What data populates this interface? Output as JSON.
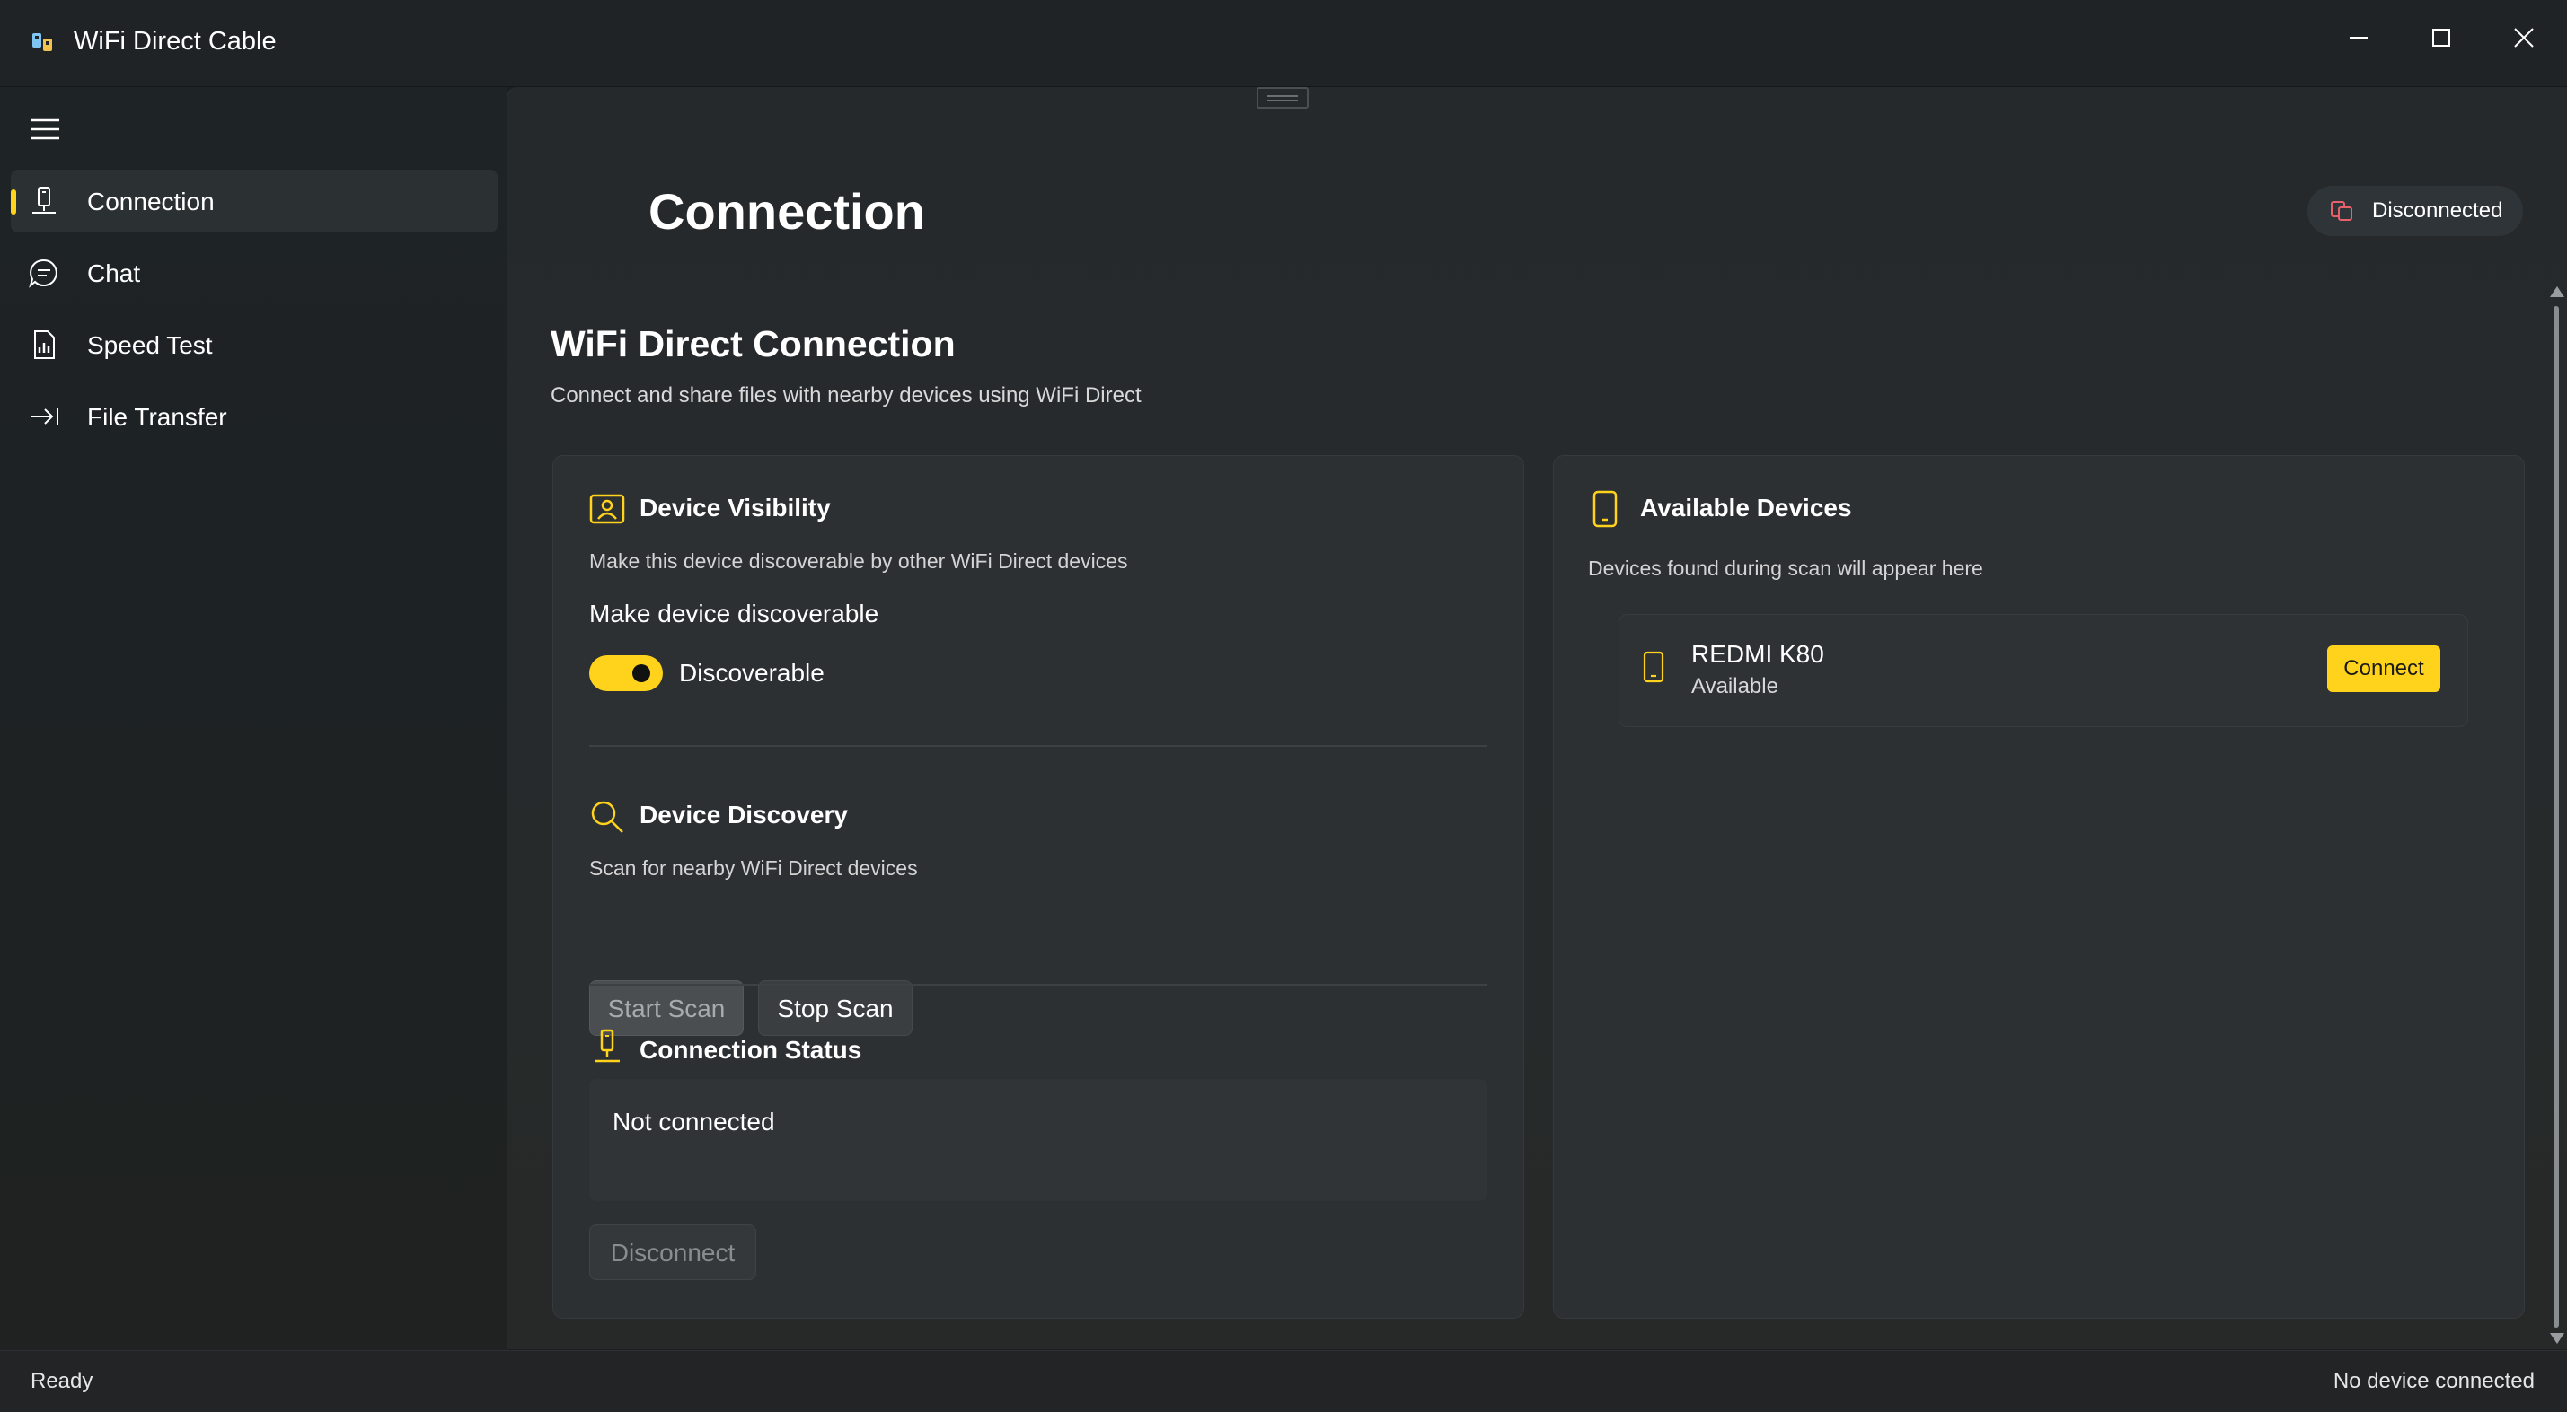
{
  "window": {
    "title": "WiFi Direct Cable",
    "controls": [
      "minimize-icon",
      "maximize-icon",
      "close-icon"
    ]
  },
  "sidebar": {
    "menu_icon": "hamburger-menu-icon",
    "items": [
      {
        "label": "Connection",
        "icon": "connection-icon",
        "active": true
      },
      {
        "label": "Chat",
        "icon": "chat-icon",
        "active": false
      },
      {
        "label": "Speed Test",
        "icon": "speed-test-icon",
        "active": false
      },
      {
        "label": "File Transfer",
        "icon": "file-transfer-icon",
        "active": false
      }
    ]
  },
  "header": {
    "title": "Connection",
    "status_badge": "Disconnected"
  },
  "section": {
    "title": "WiFi Direct Connection",
    "subtitle": "Connect and share files with nearby devices using WiFi Direct"
  },
  "visibility": {
    "title": "Device Visibility",
    "description": "Make this device discoverable by other WiFi Direct devices",
    "toggle_label": "Make device discoverable",
    "toggle_state": "Discoverable",
    "toggle_on": true
  },
  "discovery": {
    "title": "Device Discovery",
    "description": "Scan for nearby WiFi Direct devices",
    "start_label": "Start Scan",
    "stop_label": "Stop Scan"
  },
  "connection_status": {
    "title": "Connection Status",
    "value": "Not connected",
    "disconnect_label": "Disconnect"
  },
  "available": {
    "title": "Available Devices",
    "description": "Devices found during scan will appear here",
    "devices": [
      {
        "name": "REDMI K80",
        "status": "Available",
        "action": "Connect"
      }
    ]
  },
  "statusbar": {
    "left": "Ready",
    "right": "No device connected"
  },
  "colors": {
    "accent": "#ffd21c",
    "badge_icon": "#e8606c",
    "background": "#1c1f21",
    "card": "#2c3033"
  }
}
